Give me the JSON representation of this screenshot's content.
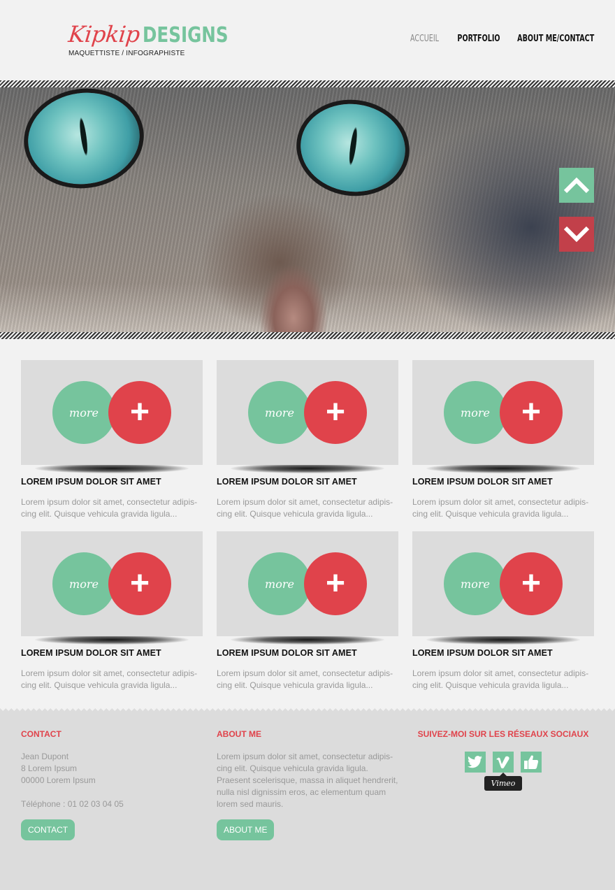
{
  "header": {
    "logo_script": "Kipkip",
    "logo_designs": "DESIGNS",
    "tagline": "MAQUETTISTE / INFOGRAPHISTE",
    "nav": [
      "ACCUEIL",
      "PORTFOLIO",
      "ABOUT ME/CONTACT"
    ]
  },
  "hero": {
    "up_icon": "chevron-up-icon",
    "down_icon": "chevron-down-icon"
  },
  "cards": [
    {
      "more": "more",
      "plus": "+",
      "title": "LOREM IPSUM DOLOR SIT AMET",
      "text": "Lorem ipsum dolor sit amet, consectetur adipis-cing elit. Quisque vehicula gravida ligula..."
    },
    {
      "more": "more",
      "plus": "+",
      "title": "LOREM IPSUM DOLOR SIT AMET",
      "text": "Lorem ipsum dolor sit amet, consectetur adipis-cing elit. Quisque vehicula gravida ligula..."
    },
    {
      "more": "more",
      "plus": "+",
      "title": "LOREM IPSUM DOLOR SIT AMET",
      "text": "Lorem ipsum dolor sit amet, consectetur adipis-cing elit. Quisque vehicula gravida ligula..."
    },
    {
      "more": "more",
      "plus": "+",
      "title": "LOREM IPSUM DOLOR SIT AMET",
      "text": "Lorem ipsum dolor sit amet, consectetur adipis-cing elit. Quisque vehicula gravida ligula..."
    },
    {
      "more": "more",
      "plus": "+",
      "title": "LOREM IPSUM DOLOR SIT AMET",
      "text": "Lorem ipsum dolor sit amet, consectetur adipis-cing elit. Quisque vehicula gravida ligula..."
    },
    {
      "more": "more",
      "plus": "+",
      "title": "LOREM IPSUM DOLOR SIT AMET",
      "text": "Lorem ipsum dolor sit amet, consectetur adipis-cing elit. Quisque vehicula gravida ligula..."
    }
  ],
  "footer": {
    "contact": {
      "title": "CONTACT",
      "name": "Jean Dupont",
      "address1": "8 Lorem Ipsum",
      "address2": "00000 Lorem Ipsum",
      "phone": "Téléphone : 01 02 03 04 05",
      "button": "CONTACT"
    },
    "about": {
      "title": "ABOUT ME",
      "text": "Lorem ipsum dolor sit amet, consectetur adipis-cing elit. Quisque vehicula gravida ligula. Praesent scelerisque, massa in aliquet hendrerit, nulla nisl dignissim eros, ac elementum quam lorem sed mauris.",
      "button": "ABOUT ME"
    },
    "social": {
      "title": "SUIVEZ-MOI SUR LES RÉSEAUX SOCIAUX",
      "icons": [
        "twitter-icon",
        "vimeo-icon",
        "like-icon"
      ],
      "tooltip": "Vimeo"
    }
  },
  "colors": {
    "green": "#76c49d",
    "red": "#e0434b",
    "background": "#f2f2f2",
    "footer": "#dcdcdc"
  }
}
